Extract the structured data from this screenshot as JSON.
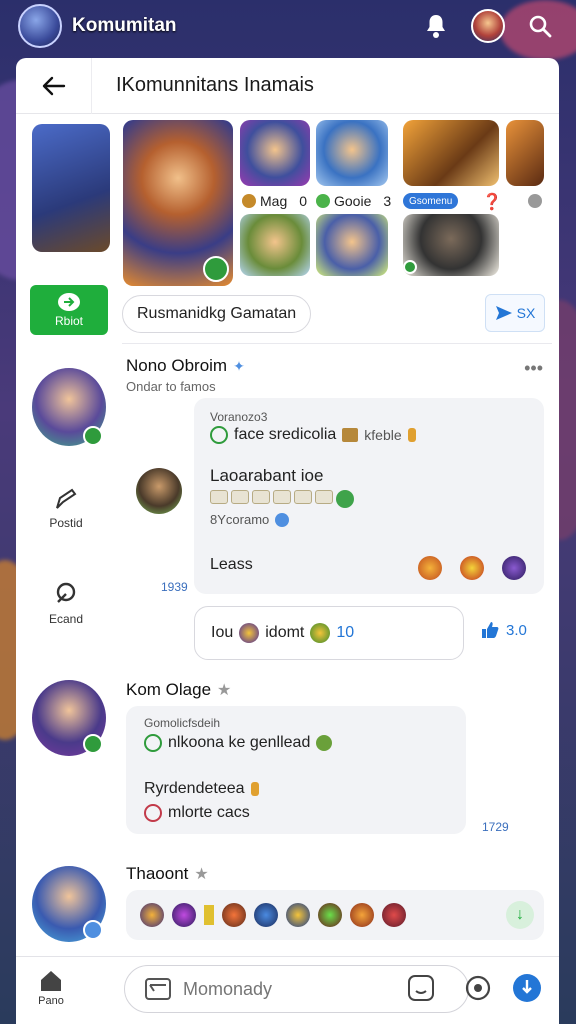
{
  "appbar": {
    "title": "Komumitan"
  },
  "card": {
    "title": "IKomunnitans Inamais"
  },
  "gallery": {
    "meta1_label": "Mag",
    "meta1_count": "0",
    "meta2_label": "Gooie",
    "meta2_count": "3",
    "tag_label": "Gsomenu"
  },
  "actions": {
    "green_button_label": "Rbiot",
    "pill_label": "Rusmanidkg Gamatan",
    "share_label": "SX"
  },
  "rail": {
    "item1_label": "Postid",
    "item2_label": "Ecand"
  },
  "post1": {
    "name": "Nono Obroim",
    "sub": "Ondar to famos",
    "small": "Voranozo3",
    "line1": "face sredicolia",
    "line1_suffix": "kfeble",
    "line2": "Laoarabant ioe",
    "line3": "8Ycoramo",
    "line4": "Leass",
    "time_left": "1939",
    "reply_text1": "Iou",
    "reply_text2": "idomt",
    "reply_count": "10",
    "like_count": "3.0"
  },
  "post2": {
    "name": "Kom Olage",
    "small": "Gomolicfsdeih",
    "line1": "nlkoona ke genllead",
    "line2": "Ryrdendeteea",
    "line3": "mlorte cacs",
    "time": "1729"
  },
  "post3": {
    "name": "Thaoont"
  },
  "bottom": {
    "home_label": "Pano",
    "input_placeholder": "Momonady"
  },
  "colors": {
    "accent_green": "#1fae3c",
    "accent_blue": "#2376d6"
  }
}
